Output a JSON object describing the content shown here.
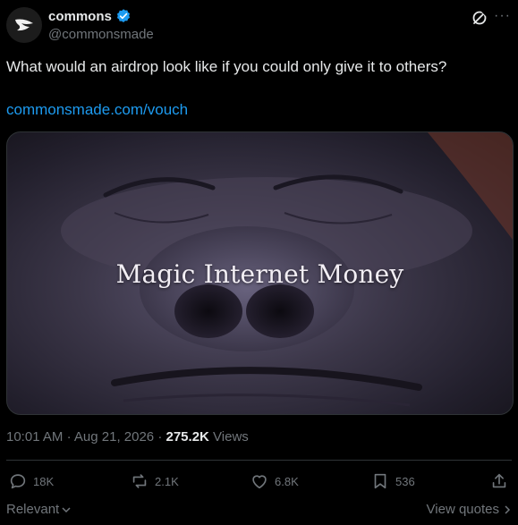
{
  "author": {
    "display_name": "commons",
    "handle": "@commonsmade",
    "verified": true
  },
  "tweet": {
    "text": "What would an airdrop look like if you could only give it to others?",
    "link": "commonsmade.com/vouch"
  },
  "media": {
    "overlay_text": "Magic Internet Money"
  },
  "meta": {
    "time": "10:01 AM",
    "date": "Aug 21, 2026",
    "views_count": "275.2K",
    "views_label": "Views"
  },
  "actions": {
    "replies": "18K",
    "reposts": "2.1K",
    "likes": "6.8K",
    "bookmarks": "536"
  },
  "footer": {
    "sort_label": "Relevant",
    "quotes_label": "View quotes"
  },
  "colors": {
    "accent": "#1d9bf0",
    "muted": "#71767b",
    "text": "#e7e9ea",
    "background": "#000000"
  },
  "icons": [
    "commons-logo-icon",
    "verified-badge-icon",
    "grok-icon",
    "more-icon",
    "reply-icon",
    "repost-icon",
    "like-icon",
    "bookmark-icon",
    "share-icon",
    "chevron-down-icon",
    "chevron-right-icon"
  ]
}
